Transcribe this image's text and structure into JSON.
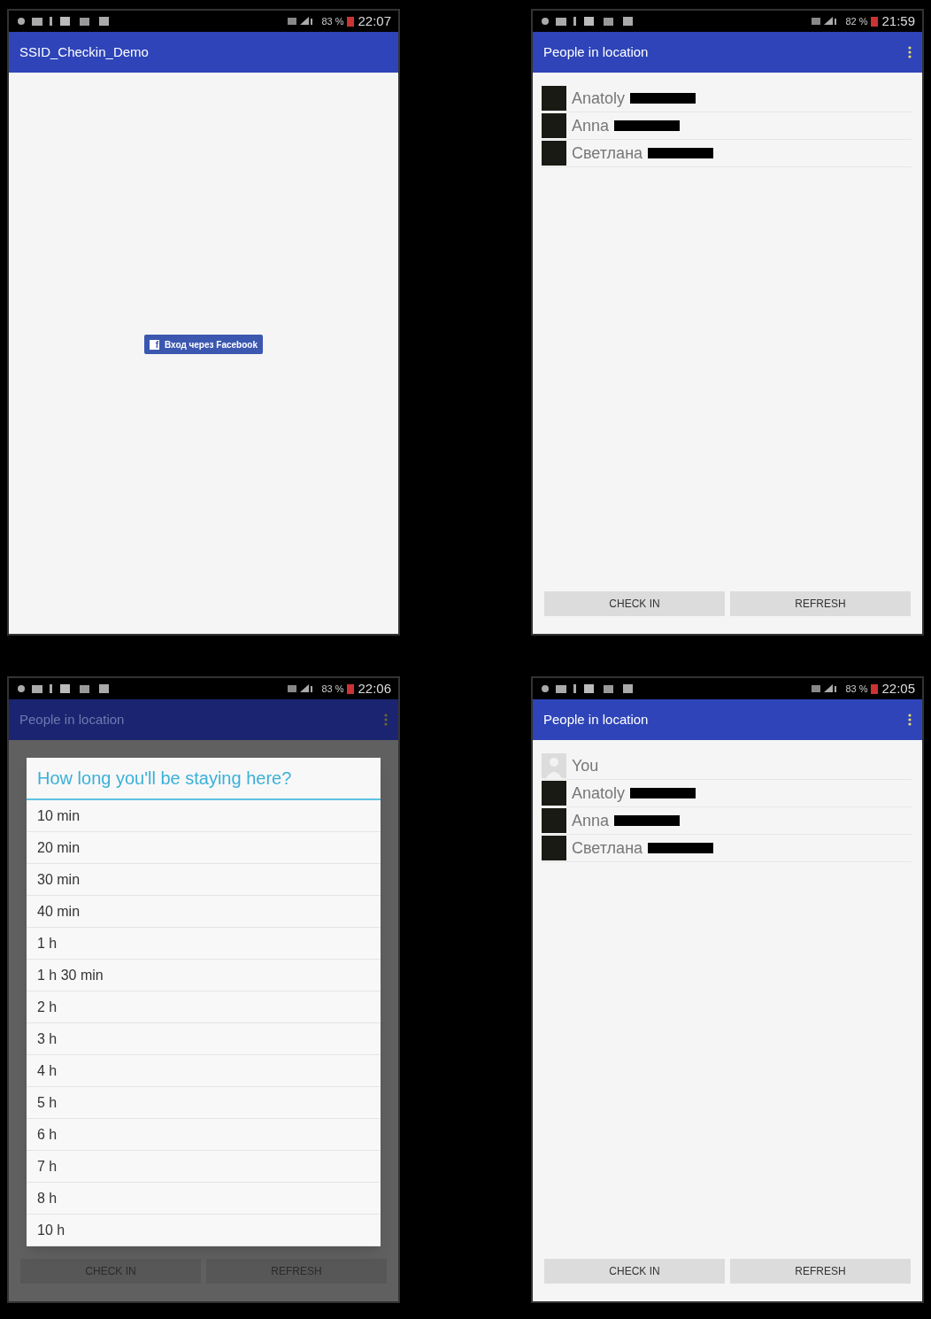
{
  "screens": [
    {
      "kind": "login",
      "status_bar": {
        "battery": "83 %",
        "time": "22:07"
      },
      "app_bar": {
        "title": "SSID_Checkin_Demo",
        "menu": false
      },
      "login_button": {
        "icon": "f",
        "label": "Вход через Facebook"
      }
    },
    {
      "kind": "list",
      "status_bar": {
        "battery": "82 %",
        "time": "21:59"
      },
      "app_bar": {
        "title": "People in location",
        "menu": true
      },
      "people": [
        {
          "name": "Anatoly",
          "self": false,
          "redacted": true
        },
        {
          "name": "Anna",
          "self": false,
          "redacted": true
        },
        {
          "name": "Светлана",
          "self": false,
          "redacted": true
        }
      ],
      "buttons": [
        "CHECK IN",
        "REFRESH"
      ]
    },
    {
      "kind": "dialog",
      "status_bar": {
        "battery": "83 %",
        "time": "22:06"
      },
      "app_bar": {
        "title": "People in location",
        "menu": true
      },
      "buttons": [
        "CHECK IN",
        "REFRESH"
      ],
      "dialog": {
        "title": "How long you'll be staying here?",
        "options": [
          "10 min",
          "20 min",
          "30 min",
          "40 min",
          "1 h",
          "1 h 30 min",
          "2 h",
          "3 h",
          "4 h",
          "5 h",
          "6 h",
          "7 h",
          "8 h",
          "10 h"
        ]
      }
    },
    {
      "kind": "list",
      "status_bar": {
        "battery": "83 %",
        "time": "22:05"
      },
      "app_bar": {
        "title": "People in location",
        "menu": true
      },
      "people": [
        {
          "name": "You",
          "self": true,
          "redacted": false
        },
        {
          "name": "Anatoly",
          "self": false,
          "redacted": true
        },
        {
          "name": "Anna",
          "self": false,
          "redacted": true
        },
        {
          "name": "Светлана",
          "self": false,
          "redacted": true
        }
      ],
      "buttons": [
        "CHECK IN",
        "REFRESH"
      ]
    }
  ]
}
